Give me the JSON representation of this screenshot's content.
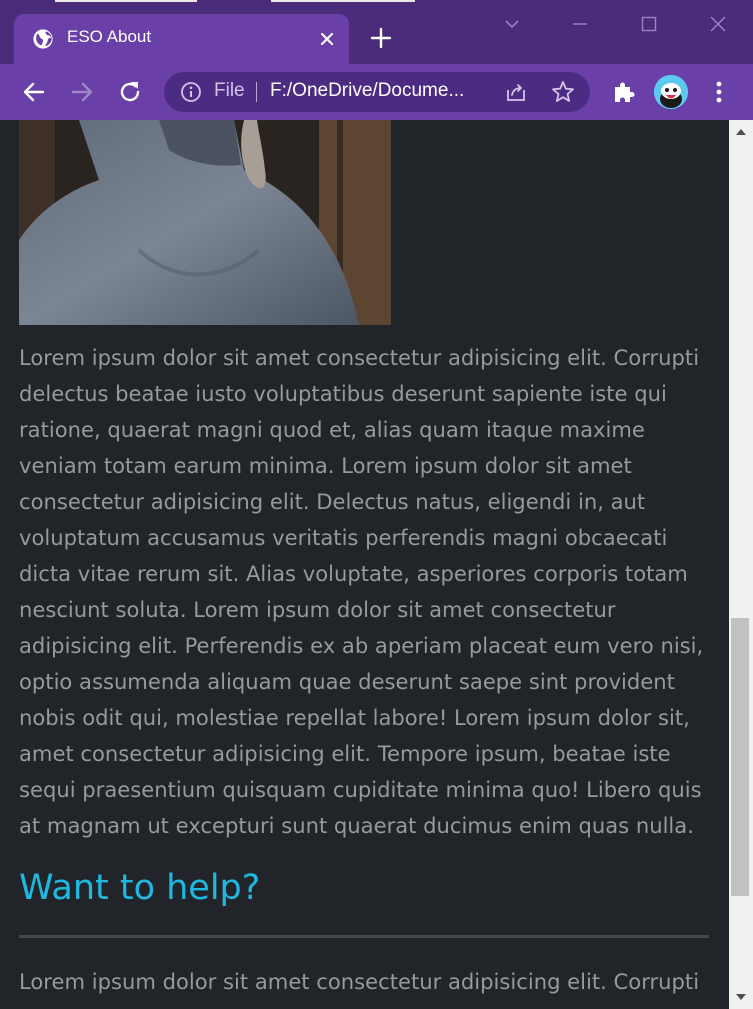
{
  "browser": {
    "tab": {
      "title": "ESO About",
      "icon": "globe-icon"
    },
    "address_bar": {
      "scheme_label": "File",
      "url": "F:/OneDrive/Docume..."
    },
    "colors": {
      "frame": "#4a2c7a",
      "active_tab": "#6a3fa8",
      "omnibox": "#4c2c82"
    }
  },
  "page": {
    "image": {
      "alt": "character portrait"
    },
    "paragraph_1": "Lorem ipsum dolor sit amet consectetur adipisicing elit. Corrupti delectus beatae iusto voluptatibus deserunt sapiente iste qui ratione, quaerat magni quod et, alias quam itaque maxime veniam totam earum minima. Lorem ipsum dolor sit amet consectetur adipisicing elit. Delectus natus, eligendi in, aut voluptatum accusamus veritatis perferendis magni obcaecati dicta vitae rerum sit. Alias voluptate, asperiores corporis totam nesciunt soluta. Lorem ipsum dolor sit amet consectetur adipisicing elit. Perferendis ex ab aperiam placeat eum vero nisi, optio assumenda aliquam quae deserunt saepe sint provident nobis odit qui, molestiae repellat labore! Lorem ipsum dolor sit, amet consectetur adipisicing elit. Tempore ipsum, beatae iste sequi praesentium quisquam cupiditate minima quo! Libero quis at magnam ut excepturi sunt quaerat ducimus enim quas nulla.",
    "heading": "Want to help?",
    "paragraph_2": "Lorem ipsum dolor sit amet consectetur adipisicing elit. Corrupti",
    "colors": {
      "background": "#212529",
      "text": "#959a9f",
      "heading": "#1fb8e0"
    }
  }
}
